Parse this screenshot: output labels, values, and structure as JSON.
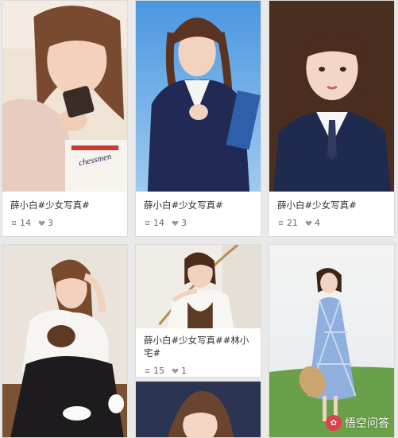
{
  "cards": [
    {
      "caption": "薛小白#少女写真#",
      "reposts": "14",
      "likes": "3"
    },
    {
      "caption": "薛小白#少女写真#",
      "reposts": "14",
      "likes": "3"
    },
    {
      "caption": "薛小白#少女写真#",
      "reposts": "21",
      "likes": "4"
    },
    {
      "caption": "薛小白#少女写真##林小宅#",
      "reposts": "15",
      "likes": "1"
    }
  ],
  "photo_text": {
    "package_label": "chessmen"
  },
  "watermark": {
    "label": "悟空问答"
  },
  "colors": {
    "caption_text": "#333333",
    "stats_text": "#666666",
    "card_border": "#dcdcdc",
    "page_bg": "#e9e9e9",
    "brand": "#e0404a"
  },
  "icons": {
    "repost": "repost-icon",
    "like": "heart-icon"
  }
}
